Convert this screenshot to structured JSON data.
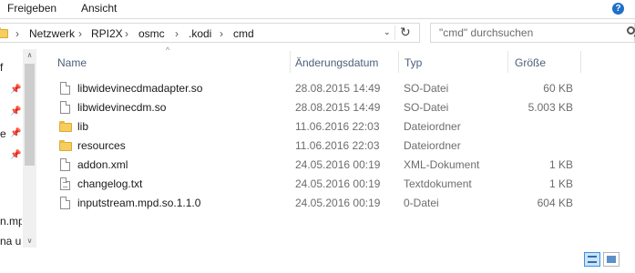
{
  "ribbon": {
    "tabs": [
      "Freigeben",
      "Ansicht"
    ],
    "help_symbol": "?"
  },
  "address": {
    "icon": "folder-icon",
    "crumbs": [
      "Netzwerk",
      "RPI2X",
      "osmc",
      ".kodi",
      "cmd"
    ],
    "separator": "›",
    "dropdown_symbol": "⌄",
    "refresh_symbol": "↻"
  },
  "search": {
    "placeholder": "\"cmd\" durchsuchen",
    "value": "",
    "icon": "search-icon"
  },
  "nav_pane": {
    "fragments": [
      "f",
      "",
      "e",
      "",
      "",
      "n.mp",
      "na ur"
    ],
    "pin_icon": "pin-icon",
    "pin_symbol": "📌",
    "scroll_up": "∧",
    "scroll_down": "∨"
  },
  "columns": {
    "name": "Name",
    "date": "Änderungsdatum",
    "type": "Typ",
    "size": "Größe",
    "sort_symbol": "^"
  },
  "files": [
    {
      "name": "libwidevinecdmadapter.so",
      "date": "28.08.2015 14:49",
      "type": "SO-Datei",
      "size": "60 KB",
      "icon": "file-icon"
    },
    {
      "name": "libwidevinecdm.so",
      "date": "28.08.2015 14:49",
      "type": "SO-Datei",
      "size": "5.003 KB",
      "icon": "file-icon"
    },
    {
      "name": "lib",
      "date": "11.06.2016 22:03",
      "type": "Dateiordner",
      "size": "",
      "icon": "folder-icon"
    },
    {
      "name": "resources",
      "date": "11.06.2016 22:03",
      "type": "Dateiordner",
      "size": "",
      "icon": "folder-icon"
    },
    {
      "name": "addon.xml",
      "date": "24.05.2016 00:19",
      "type": "XML-Dokument",
      "size": "1 KB",
      "icon": "file-icon"
    },
    {
      "name": "changelog.txt",
      "date": "24.05.2016 00:19",
      "type": "Textdokument",
      "size": "1 KB",
      "icon": "text-file-icon"
    },
    {
      "name": "inputstream.mpd.so.1.1.0",
      "date": "24.05.2016 00:19",
      "type": "0-Datei",
      "size": "604 KB",
      "icon": "file-icon"
    }
  ],
  "view": {
    "details_icon": "view-details-icon",
    "tiles_icon": "view-tiles-icon"
  },
  "colors": {
    "header_text": "#4c607a",
    "secondary_text": "#6d6d6d",
    "folder": "#f6cd5f",
    "accent": "#3a8ee6"
  }
}
